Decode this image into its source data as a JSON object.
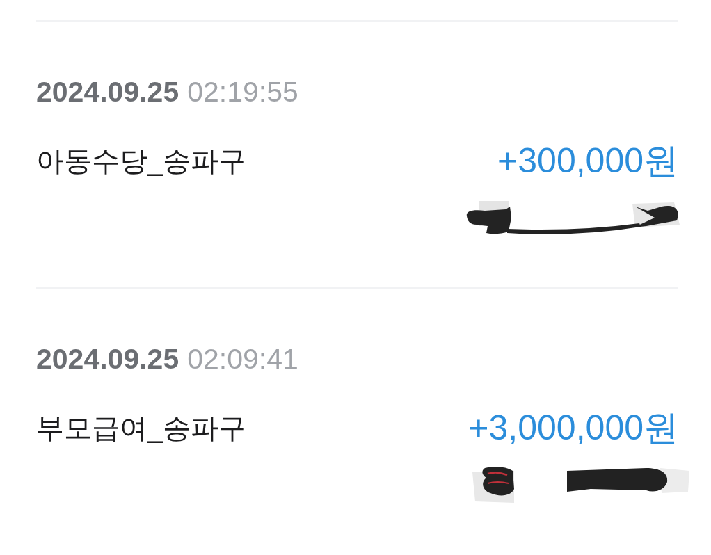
{
  "transactions": [
    {
      "date": "2024.09.25",
      "time": "02:19:55",
      "description": "아동수당_송파구",
      "amount": "+300,000원",
      "balance_redacted": true
    },
    {
      "date": "2024.09.25",
      "time": "02:09:41",
      "description": "부모급여_송파구",
      "amount": "+3,000,000원",
      "balance_redacted": true
    }
  ]
}
